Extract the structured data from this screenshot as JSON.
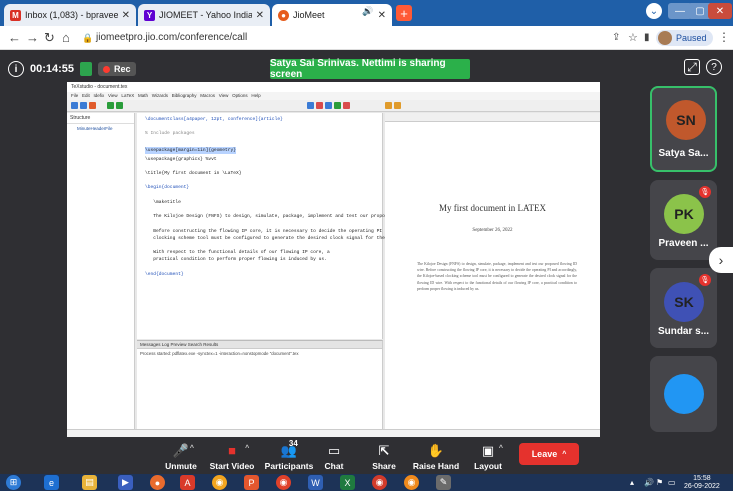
{
  "browser": {
    "tabs": [
      {
        "title": "Inbox (1,083) - bpraveen@pscm...",
        "icon": "gmail-icon",
        "color": "#d93025"
      },
      {
        "title": "JIOMEET - Yahoo India Search Re...",
        "icon": "yahoo-icon",
        "color": "#6001d2"
      },
      {
        "title": "JioMeet",
        "icon": "jiomeet-icon",
        "color": "#e65c1c"
      }
    ],
    "new_tab": "+",
    "url": "jiomeetpro.jio.com/conference/call",
    "paused_label": "Paused"
  },
  "meeting": {
    "duration": "00:14:55",
    "rec_label": "Rec",
    "sharing_banner": "Satya Sai Srinivas. Nettimi is sharing screen"
  },
  "shared_screen": {
    "doc_title": "My first document in LATEX",
    "doc_date": "September 26, 2022",
    "doc_body": "The Kilojoe Design (FNFS) to design, simulate, package, implement and test our proposed flowing ID wire.   Before constructing the flowing IP core, it is necessary to decide the operating PI and accordingly, the Kilojoe-based clocking scheme tool must be configured to generate the desired clock signal for the flowing ID wire.   With respect to the functional details of our flowing IP core, a practical condition to perform proper flowing is induced by us.",
    "code_lines": [
      {
        "t": "\\documentclass[a4paper, 12pt, conference]{article}",
        "c": "kw"
      },
      {
        "t": "",
        "c": ""
      },
      {
        "t": "% Include packages",
        "c": "cm"
      },
      {
        "t": "\\usepackage[margin=1in]{geometry}",
        "c": "hl"
      },
      {
        "t": "\\usepackage{graphicx} %vvt",
        "c": ""
      },
      {
        "t": "",
        "c": ""
      },
      {
        "t": "\\title{My first document in \\LaTeX}",
        "c": ""
      },
      {
        "t": "",
        "c": ""
      },
      {
        "t": "\\begin{document}",
        "c": "kw"
      },
      {
        "t": "",
        "c": ""
      },
      {
        "t": "   \\maketitle",
        "c": ""
      },
      {
        "t": "",
        "c": ""
      },
      {
        "t": "   The Kilojoe Design (FNFS) to design, simulate, package, implement and test our proposed flowing ID wire.",
        "c": ""
      },
      {
        "t": "",
        "c": ""
      },
      {
        "t": "   Before constructing the flowing IP core, it is necessary to decide the operating PI and accordingly, the Kilojoe-based",
        "c": ""
      },
      {
        "t": "   clocking scheme tool must be configured to generate the desired clock signal for the flowing ID wire.",
        "c": ""
      },
      {
        "t": "",
        "c": ""
      },
      {
        "t": "   With respect to the functional details of our flowing IP core, a",
        "c": ""
      },
      {
        "t": "   practical condition to perform proper flowing is induced by us.",
        "c": ""
      },
      {
        "t": "",
        "c": ""
      },
      {
        "t": "\\end{document}",
        "c": "kw"
      }
    ],
    "structure_node": "MinuteHeaderFile",
    "log_tabs": "Messages   Log   Preview   Search Results",
    "log_text": "Process started: pdflatex.exe -synctex=1 -interaction=nonstopmode \"document\".tex"
  },
  "participants": [
    {
      "initials": "SN",
      "name": "Satya Sa...",
      "color": "#c0582c",
      "active": true,
      "muted": false
    },
    {
      "initials": "PK",
      "name": "Praveen ...",
      "color": "#8bc34a",
      "active": false,
      "muted": true
    },
    {
      "initials": "SK",
      "name": "Sundar s...",
      "color": "#3f51b5",
      "active": false,
      "muted": true
    },
    {
      "initials": "",
      "name": "",
      "color": "#2196f3",
      "active": false,
      "muted": false
    }
  ],
  "controls": {
    "unmute": "Unmute",
    "start_video": "Start Video",
    "participants": "Participants",
    "participants_count": "34",
    "chat": "Chat",
    "share": "Share",
    "raise_hand": "Raise Hand",
    "layout": "Layout",
    "leave": "Leave"
  },
  "taskbar": {
    "time": "15:58",
    "date": "26-09-2022"
  }
}
